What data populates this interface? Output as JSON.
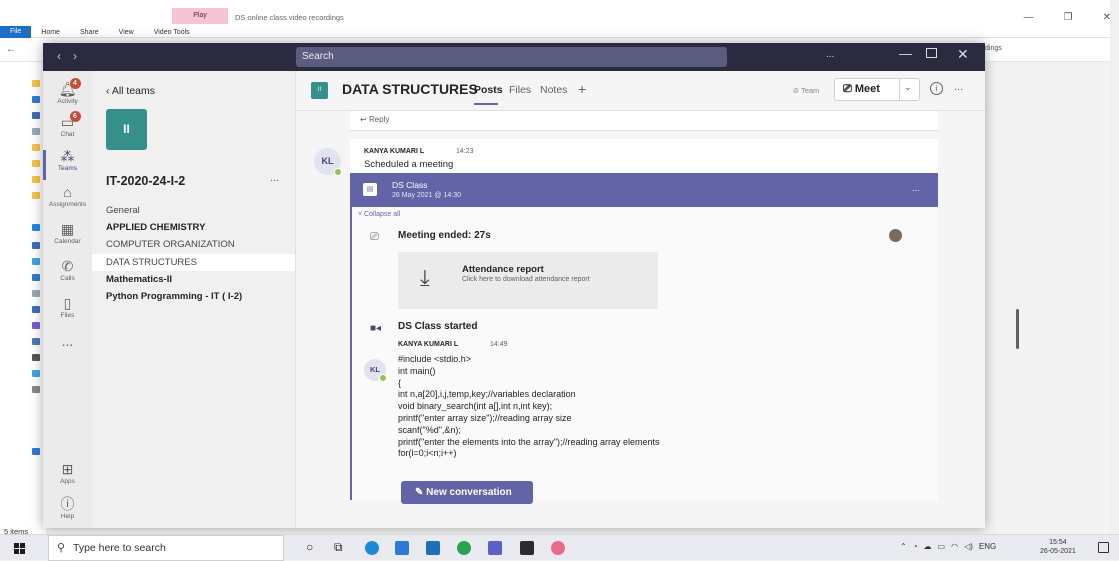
{
  "explorer": {
    "title": "DS online class video recordings",
    "tabs": [
      "File",
      "Home",
      "Share",
      "View",
      "Video Tools"
    ],
    "play_tab": "Play",
    "address_tail": "dings",
    "status": "5 items"
  },
  "teams": {
    "search_placeholder": "Search",
    "titlebar_more": "...",
    "rail": [
      {
        "label": "Activity",
        "badge": "4"
      },
      {
        "label": "Chat",
        "badge": "6"
      },
      {
        "label": "Teams",
        "badge": ""
      },
      {
        "label": "Assignments",
        "badge": ""
      },
      {
        "label": "Calendar",
        "badge": ""
      },
      {
        "label": "Calls",
        "badge": ""
      },
      {
        "label": "Files",
        "badge": ""
      },
      {
        "label": "...",
        "badge": ""
      }
    ],
    "rail_bottom": [
      {
        "label": "Apps"
      },
      {
        "label": "Help"
      }
    ],
    "panel": {
      "back_label": "All teams",
      "team_tile": "II",
      "team_name": "IT-2020-24-I-2",
      "team_more": "...",
      "channels": [
        {
          "name": "General",
          "bold": false,
          "selected": false
        },
        {
          "name": "APPLIED CHEMISTRY",
          "bold": true,
          "selected": false
        },
        {
          "name": "COMPUTER ORGANIZATION",
          "bold": false,
          "selected": false
        },
        {
          "name": "DATA STRUCTURES",
          "bold": false,
          "selected": true
        },
        {
          "name": "Mathematics-II",
          "bold": true,
          "selected": false
        },
        {
          "name": "Python Programming - IT ( I-2)",
          "bold": true,
          "selected": false
        }
      ]
    },
    "header": {
      "tile": "II",
      "channel": "DATA STRUCTURES",
      "tabs": [
        "Posts",
        "Files",
        "Notes"
      ],
      "add": "+",
      "team_btn": "Team",
      "meet": "Meet",
      "more": "..."
    },
    "thread": {
      "reply": "Reply",
      "msg1": {
        "initials": "KL",
        "author": "KANYA KUMARI L",
        "time": "14:23",
        "text": "Scheduled a meeting"
      },
      "meeting": {
        "name": "DS Class",
        "date": "26 May 2021 @ 14:30",
        "more": "..."
      },
      "collapse": "Collapse all",
      "ended": "Meeting ended: 27s",
      "attendance_title": "Attendance report",
      "attendance_sub": "Click here to download attendance report",
      "started": "DS Class started",
      "msg2": {
        "initials": "KL",
        "author": "KANYA KUMARI L",
        "time": "14:49",
        "code": [
          "#include <stdio.h>",
          "int main()",
          "{",
          "int n,a[20],i,j,temp,key;//variables declaration",
          "void binary_search(int a[],int n,int key);",
          "printf(\"enter array size\");//reading array size",
          "scanf(\"%d\",&n);",
          "printf(\"enter the elements into the array\");//reading array elements",
          "for(i=0;i<n;i++)"
        ]
      }
    },
    "new_conversation": "New conversation"
  },
  "taskbar": {
    "search_placeholder": "Type here to search",
    "lang": "ENG",
    "time": "15:54",
    "date": "26-05-2021"
  }
}
